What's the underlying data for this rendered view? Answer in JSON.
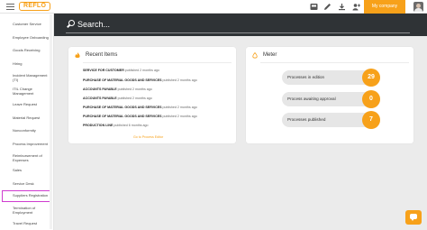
{
  "topbar": {
    "logo_text": "REFLO",
    "company_button_label": "My company",
    "icons": [
      "menu-icon",
      "inbox-icon",
      "edit-icon",
      "download-icon",
      "user-add-icon"
    ],
    "accent_color": "#f7a11a"
  },
  "sidebar": {
    "items": [
      {
        "label": "Customer Service"
      },
      {
        "label": "Employee Onboarding"
      },
      {
        "label": "Goods Receiving"
      },
      {
        "label": "Hiring"
      },
      {
        "label": "Incident Management (TI)"
      },
      {
        "label": "ITIL Change Management"
      },
      {
        "label": "Leave Request"
      },
      {
        "label": "Material Request"
      },
      {
        "label": "Nonconformity"
      },
      {
        "label": "Process Improvement"
      },
      {
        "label": "Reimbursement of Expenses"
      },
      {
        "label": "Sales"
      },
      {
        "label": "Service Desk"
      },
      {
        "label": "Suppliers Registration",
        "selected": true
      },
      {
        "label": "Termination of Employment"
      },
      {
        "label": "Travel Request"
      }
    ]
  },
  "search": {
    "placeholder": "Search..."
  },
  "recent": {
    "title": "Recent Items",
    "items": [
      {
        "name": "SERVICE FOR CUSTOMER",
        "meta": "published 2 months ago"
      },
      {
        "name": "PURCHASE OF MATERIAL GOODS AND SERVICES",
        "meta": "published 2 months ago"
      },
      {
        "name": "ACCOUNTS PAYABLE",
        "meta": "published 2 months ago"
      },
      {
        "name": "ACCOUNTS PAYABLE",
        "meta": "published 2 months ago"
      },
      {
        "name": "PURCHASE OF MATERIAL GOODS AND SERVICES",
        "meta": "published 2 months ago"
      },
      {
        "name": "PURCHASE OF MATERIAL GOODS AND SERVICES",
        "meta": "published 2 months ago"
      },
      {
        "name": "PRODUCTION LINE",
        "meta": "published 6 months ago"
      }
    ],
    "link_label": "Go to Process Editor"
  },
  "meter": {
    "title": "Meter",
    "rows": [
      {
        "label": "Processes in edition",
        "count": "29"
      },
      {
        "label": "Process awaiting approval",
        "count": "0"
      },
      {
        "label": "Processes published",
        "count": "7"
      }
    ]
  }
}
